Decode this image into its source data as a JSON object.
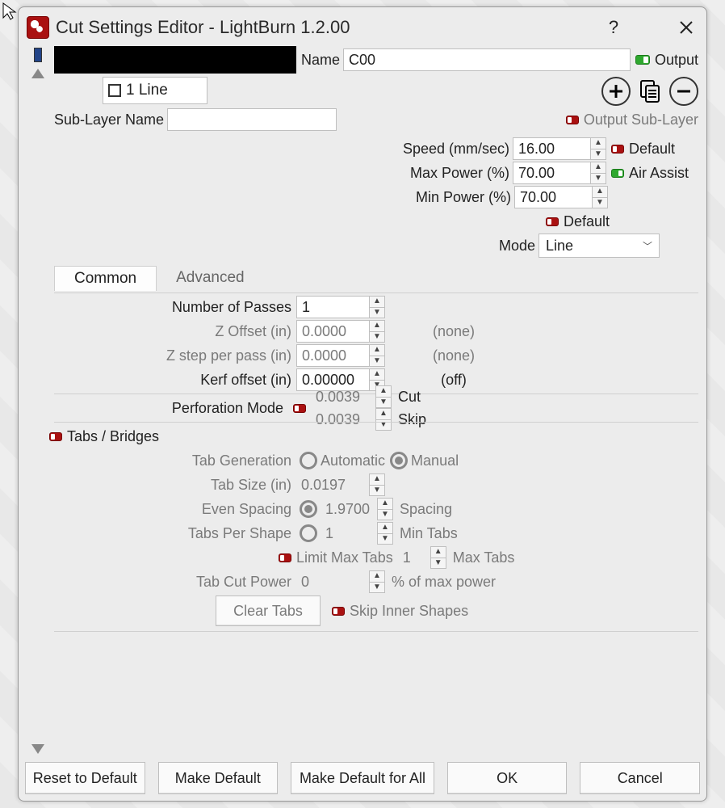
{
  "window": {
    "title": "Cut Settings Editor - LightBurn 1.2.00"
  },
  "header": {
    "name_label": "Name",
    "name_value": "C00",
    "output_label": "Output"
  },
  "sublayer": {
    "row_label": "1 Line",
    "name_label": "Sub-Layer Name",
    "name_value": "",
    "output_label": "Output Sub-Layer"
  },
  "params": {
    "speed_label": "Speed (mm/sec)",
    "speed_value": "16.00",
    "default_label": "Default",
    "maxpower_label": "Max Power (%)",
    "maxpower_value": "70.00",
    "airassist_label": "Air Assist",
    "minpower_label": "Min Power (%)",
    "minpower_value": "70.00",
    "mode_label": "Mode",
    "mode_value": "Line"
  },
  "tabs": {
    "common": "Common",
    "advanced": "Advanced"
  },
  "common": {
    "passes_label": "Number of Passes",
    "passes_value": "1",
    "zoffset_label": "Z Offset (in)",
    "zoffset_value": "0.0000",
    "zoffset_extra": "(none)",
    "zstep_label": "Z step per pass (in)",
    "zstep_value": "0.0000",
    "zstep_extra": "(none)",
    "kerf_label": "Kerf offset (in)",
    "kerf_value": "0.00000",
    "kerf_extra": "(off)",
    "perf_label": "Perforation Mode",
    "perf_cut_value": "0.0039",
    "perf_cut_suffix": "Cut",
    "perf_skip_value": "0.0039",
    "perf_skip_suffix": "Skip"
  },
  "tabs_bridges": {
    "section_label": "Tabs / Bridges",
    "tabgen_label": "Tab Generation",
    "tabgen_auto": "Automatic",
    "tabgen_manual": "Manual",
    "tabsize_label": "Tab Size (in)",
    "tabsize_value": "0.0197",
    "evenspacing_label": "Even Spacing",
    "evenspacing_value": "1.9700",
    "evenspacing_suffix": "Spacing",
    "pershape_label": "Tabs Per Shape",
    "pershape_value": "1",
    "pershape_suffix": "Min Tabs",
    "limitmax_label": "Limit Max Tabs",
    "limitmax_value": "1",
    "limitmax_suffix": "Max Tabs",
    "cutpower_label": "Tab Cut Power",
    "cutpower_value": "0",
    "cutpower_suffix": "% of max power",
    "clear_label": "Clear Tabs",
    "skipinner_label": "Skip Inner Shapes"
  },
  "footer": {
    "reset": "Reset to Default",
    "make_default": "Make Default",
    "make_default_all": "Make Default for All",
    "ok": "OK",
    "cancel": "Cancel"
  }
}
